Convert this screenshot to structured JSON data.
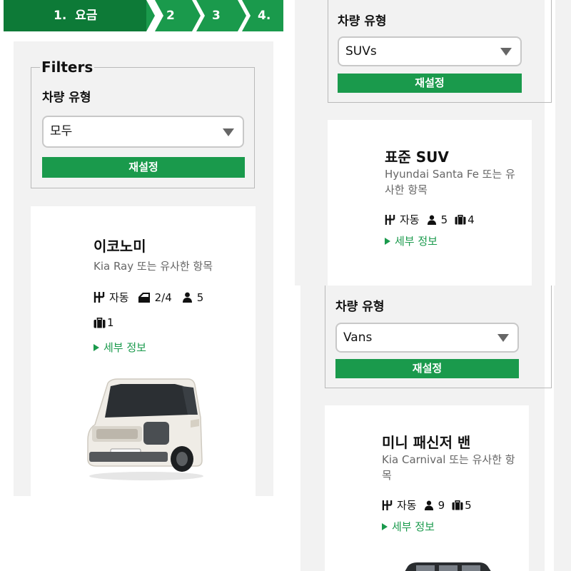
{
  "stepper": {
    "steps": [
      "1.  요금",
      "2",
      "3",
      "4."
    ]
  },
  "panel_economy": {
    "filters": {
      "legend": "Filters",
      "label": "차량 유형",
      "value": "모두",
      "reset": "재설정"
    },
    "card": {
      "title": "이코노미",
      "subtitle": "Kia Ray 또는 유사한 항목",
      "transmission": "자동",
      "doors": "2/4",
      "seats": "5",
      "bags": "1",
      "details": "세부 정보"
    }
  },
  "panel_suv": {
    "filters": {
      "label": "차량 유형",
      "value": "SUVs",
      "reset": "재설정"
    },
    "card": {
      "title": "표준 SUV",
      "subtitle_line1": "Hyundai Santa Fe 또는 유",
      "subtitle_line2": "사한 항목",
      "transmission": "자동",
      "seats": "5",
      "bags": "4",
      "details": "세부 정보"
    }
  },
  "panel_van": {
    "filters": {
      "label": "차량 유형",
      "value": "Vans",
      "reset": "재설정"
    },
    "card": {
      "title": "미니 패신저 밴",
      "subtitle_line1": "Kia Carnival 또는 유사한 항",
      "subtitle_line2": "목",
      "transmission": "자동",
      "seats": "9",
      "bags": "5",
      "details": "세부 정보"
    }
  },
  "colors": {
    "brand_green": "#1a9a4c",
    "active_step": "#0d7a37",
    "panel_gray": "#f2f2f2"
  }
}
